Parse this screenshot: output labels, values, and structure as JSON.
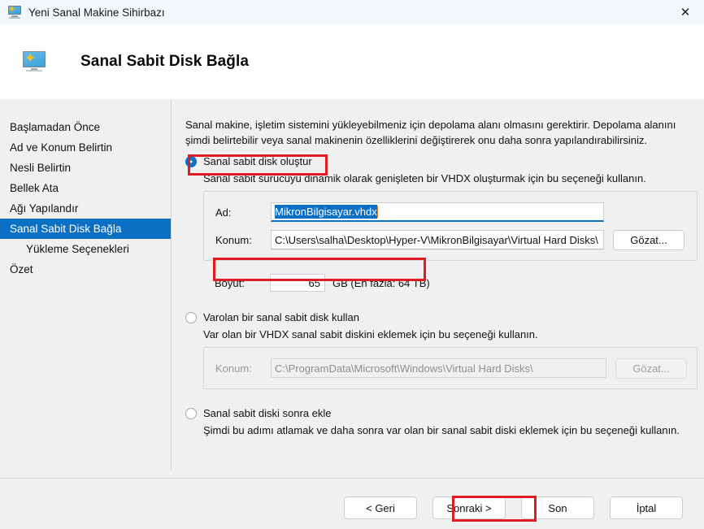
{
  "window": {
    "title": "Yeni Sanal Makine Sihirbazı",
    "icon": "virtual-machine-monitor-icon",
    "close_label": "✕"
  },
  "header": {
    "title": "Sanal Sabit Disk Bağla",
    "icon": "virtual-machine-monitor-icon"
  },
  "sidebar": {
    "items": [
      {
        "label": "Başlamadan Önce",
        "selected": false,
        "sub": false
      },
      {
        "label": "Ad ve Konum Belirtin",
        "selected": false,
        "sub": false
      },
      {
        "label": "Nesli Belirtin",
        "selected": false,
        "sub": false
      },
      {
        "label": "Bellek Ata",
        "selected": false,
        "sub": false
      },
      {
        "label": "Ağı Yapılandır",
        "selected": false,
        "sub": false
      },
      {
        "label": "Sanal Sabit Disk Bağla",
        "selected": true,
        "sub": false
      },
      {
        "label": "Yükleme Seçenekleri",
        "selected": false,
        "sub": true
      },
      {
        "label": "Özet",
        "selected": false,
        "sub": false
      }
    ]
  },
  "main": {
    "intro": "Sanal makine, işletim sistemini yükleyebilmeniz için depolama alanı olmasını gerektirir. Depolama alanını şimdi belirtebilir veya sanal makinenin özelliklerini değiştirerek onu daha sonra yapılandırabilirsiniz.",
    "option_create": {
      "label": "Sanal sabit disk oluştur",
      "selected": true,
      "description": "Sanal sabit sürücüyü dinamik olarak genişleten bir VHDX oluşturmak için bu seçeneği kullanın.",
      "name_label": "Ad:",
      "name_value": "MikronBilgisayar.vhdx",
      "name_selected": true,
      "location_label": "Konum:",
      "location_value": "C:\\Users\\salha\\Desktop\\Hyper-V\\MikronBilgisayar\\Virtual Hard Disks\\",
      "browse_label": "Gözat...",
      "size_label": "Boyut:",
      "size_value": "65",
      "size_suffix": "GB (En fazla: 64 TB)"
    },
    "option_existing": {
      "label": "Varolan bir sanal sabit disk kullan",
      "selected": false,
      "description": "Var olan bir VHDX sanal sabit diskini eklemek için bu seçeneği kullanın.",
      "location_label": "Konum:",
      "location_value": "C:\\ProgramData\\Microsoft\\Windows\\Virtual Hard Disks\\",
      "browse_label": "Gözat..."
    },
    "option_later": {
      "label": "Sanal sabit diski sonra ekle",
      "selected": false,
      "description": "Şimdi bu adımı atlamak ve daha sonra var olan bir sanal sabit diski eklemek için bu seçeneği kullanın."
    }
  },
  "footer": {
    "back_label": "< Geri",
    "next_label": "Sonraki >",
    "finish_label": "Son",
    "cancel_label": "İptal"
  },
  "annotations": {
    "highlight_color": "#e01b24",
    "boxes": [
      "radio-create-disk",
      "size-field",
      "next-button"
    ]
  },
  "colors": {
    "accent": "#0b6fc4",
    "selection": "#0b6fc4",
    "window_bg": "#f0f0f0",
    "header_bg": "#ffffff",
    "annotation": "#e01b24"
  }
}
